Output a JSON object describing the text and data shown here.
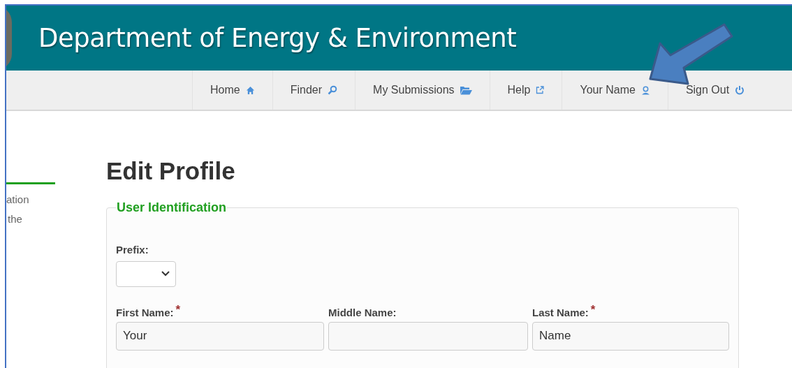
{
  "header": {
    "title": "Department of Energy & Environment"
  },
  "nav": [
    {
      "label": "Home",
      "kind": "home"
    },
    {
      "label": "Finder",
      "kind": "search"
    },
    {
      "label": "My Submissions",
      "kind": "folder"
    },
    {
      "label": "Help",
      "kind": "external"
    },
    {
      "label": "Your Name",
      "kind": "user"
    },
    {
      "label": "Sign Out",
      "kind": "power"
    }
  ],
  "sidebar": {
    "lines": [
      "ation",
      "the"
    ]
  },
  "page_title": "Edit Profile",
  "fieldset": {
    "legend": "User Identification",
    "prefix": {
      "label": "Prefix:"
    },
    "fields": [
      {
        "label": "First Name:",
        "required_mark": "*",
        "value": "Your"
      },
      {
        "label": "Middle Name:"
      },
      {
        "label": "Last Name:",
        "required_mark": "*",
        "value": "Name"
      }
    ]
  }
}
